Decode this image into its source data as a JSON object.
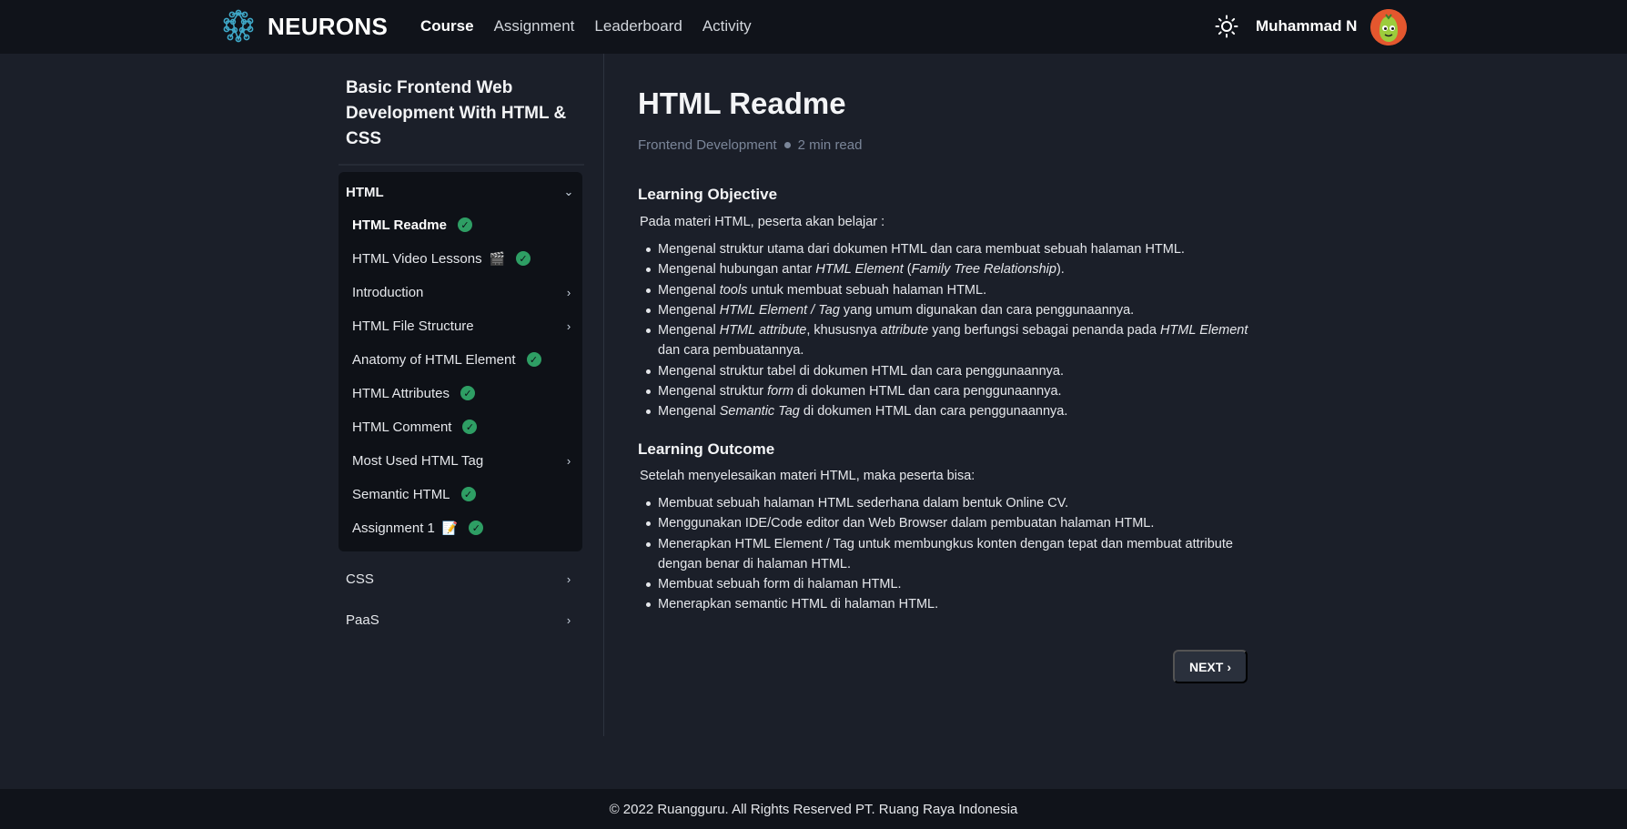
{
  "nav": {
    "brand": "NEURONS",
    "links": [
      {
        "label": "Course",
        "active": true
      },
      {
        "label": "Assignment",
        "active": false
      },
      {
        "label": "Leaderboard",
        "active": false
      },
      {
        "label": "Activity",
        "active": false
      }
    ],
    "theme_icon": "sun-icon",
    "user_name": "Muhammad N"
  },
  "sidebar": {
    "course_title": "Basic Frontend Web Development With HTML & CSS",
    "open_module": {
      "label": "HTML",
      "lessons": [
        {
          "label": "HTML Readme",
          "emoji": "",
          "completed": true,
          "has_children": false,
          "active": true
        },
        {
          "label": "HTML Video Lessons",
          "emoji": "🎬",
          "completed": true,
          "has_children": false,
          "active": false
        },
        {
          "label": "Introduction",
          "emoji": "",
          "completed": false,
          "has_children": true,
          "active": false
        },
        {
          "label": "HTML File Structure",
          "emoji": "",
          "completed": false,
          "has_children": true,
          "active": false
        },
        {
          "label": "Anatomy of HTML Element",
          "emoji": "",
          "completed": true,
          "has_children": false,
          "active": false
        },
        {
          "label": "HTML Attributes",
          "emoji": "",
          "completed": true,
          "has_children": false,
          "active": false
        },
        {
          "label": "HTML Comment",
          "emoji": "",
          "completed": true,
          "has_children": false,
          "active": false
        },
        {
          "label": "Most Used HTML Tag",
          "emoji": "",
          "completed": false,
          "has_children": true,
          "active": false
        },
        {
          "label": "Semantic HTML",
          "emoji": "",
          "completed": true,
          "has_children": false,
          "active": false
        },
        {
          "label": "Assignment 1",
          "emoji": "📝",
          "completed": true,
          "has_children": false,
          "active": false
        }
      ]
    },
    "other_modules": [
      {
        "label": "CSS"
      },
      {
        "label": "PaaS"
      }
    ]
  },
  "main": {
    "title": "HTML Readme",
    "category": "Frontend Development",
    "read_time": "2 min read",
    "objective": {
      "heading": "Learning Objective",
      "intro": "Pada materi HTML, peserta akan belajar :",
      "items": [
        [
          {
            "t": "Mengenal struktur utama dari dokumen HTML dan cara membuat sebuah halaman HTML."
          }
        ],
        [
          {
            "t": "Mengenal hubungan antar "
          },
          {
            "t": "HTML Element",
            "i": true
          },
          {
            "t": " ("
          },
          {
            "t": "Family Tree Relationship",
            "i": true
          },
          {
            "t": ")."
          }
        ],
        [
          {
            "t": "Mengenal "
          },
          {
            "t": "tools",
            "i": true
          },
          {
            "t": " untuk membuat sebuah halaman HTML."
          }
        ],
        [
          {
            "t": "Mengenal "
          },
          {
            "t": "HTML Element / Tag",
            "i": true
          },
          {
            "t": " yang umum digunakan dan cara penggunaannya."
          }
        ],
        [
          {
            "t": "Mengenal "
          },
          {
            "t": "HTML attribute",
            "i": true
          },
          {
            "t": ", khususnya "
          },
          {
            "t": "attribute",
            "i": true
          },
          {
            "t": " yang berfungsi sebagai penanda pada "
          },
          {
            "t": "HTML Element",
            "i": true
          },
          {
            "t": " dan cara pembuatannya."
          }
        ],
        [
          {
            "t": "Mengenal struktur tabel di dokumen HTML dan cara penggunaannya."
          }
        ],
        [
          {
            "t": "Mengenal struktur "
          },
          {
            "t": "form",
            "i": true
          },
          {
            "t": " di dokumen HTML dan cara penggunaannya."
          }
        ],
        [
          {
            "t": "Mengenal "
          },
          {
            "t": "Semantic Tag",
            "i": true
          },
          {
            "t": " di dokumen HTML dan cara penggunaannya."
          }
        ]
      ]
    },
    "outcome": {
      "heading": "Learning Outcome",
      "intro": "Setelah menyelesaikan materi HTML, maka peserta bisa:",
      "items": [
        [
          {
            "t": "Membuat sebuah halaman HTML sederhana dalam bentuk Online CV."
          }
        ],
        [
          {
            "t": "Menggunakan IDE/Code editor dan Web Browser dalam pembuatan halaman HTML."
          }
        ],
        [
          {
            "t": "Menerapkan HTML Element / Tag untuk membungkus konten dengan tepat dan membuat attribute dengan benar di halaman HTML."
          }
        ],
        [
          {
            "t": "Membuat sebuah form di halaman HTML."
          }
        ],
        [
          {
            "t": "Menerapkan semantic HTML di halaman HTML."
          }
        ]
      ]
    },
    "next_label": "NEXT"
  },
  "footer": {
    "text": "© 2022 Ruangguru. All Rights Reserved PT. Ruang Raya Indonesia"
  },
  "colors": {
    "background": "#1b1f29",
    "navbar": "#10131a",
    "sidebar_panel": "#0e1117",
    "check": "#2e9e64",
    "muted": "#7b8699"
  }
}
